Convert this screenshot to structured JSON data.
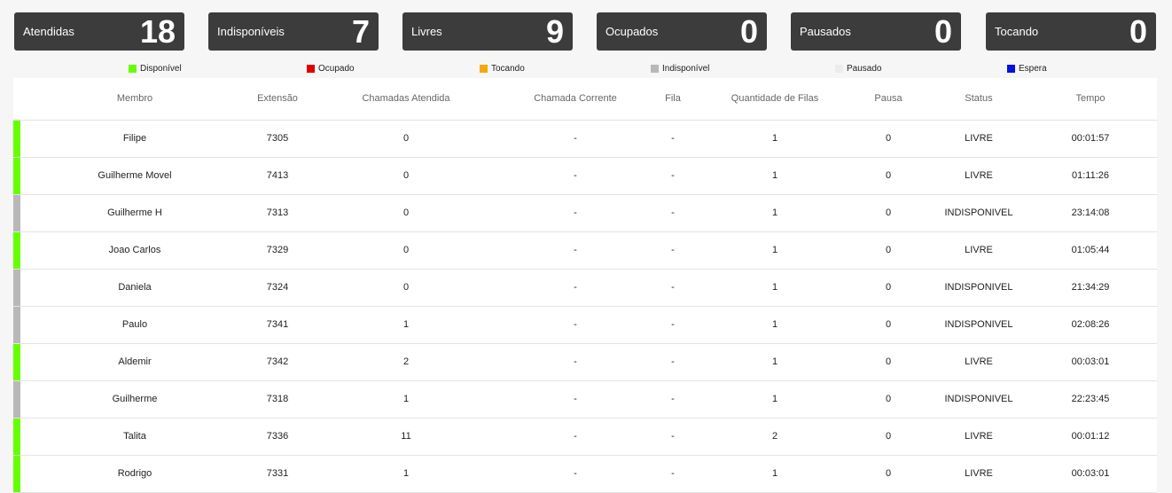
{
  "cards": [
    {
      "label": "Atendidas",
      "value": "18"
    },
    {
      "label": "Indisponíveis",
      "value": "7"
    },
    {
      "label": "Livres",
      "value": "9"
    },
    {
      "label": "Ocupados",
      "value": "0"
    },
    {
      "label": "Pausados",
      "value": "0"
    },
    {
      "label": "Tocando",
      "value": "0"
    }
  ],
  "legend": [
    {
      "label": "Disponível",
      "color": "#66ff00"
    },
    {
      "label": "Ocupado",
      "color": "#e00000"
    },
    {
      "label": "Tocando",
      "color": "#f5a800"
    },
    {
      "label": "Indisponível",
      "color": "#b8b8b8"
    },
    {
      "label": "Pausado",
      "color": "#ececec"
    },
    {
      "label": "Espera",
      "color": "#0010e0"
    }
  ],
  "table": {
    "headers": [
      "Membro",
      "Extensão",
      "Chamadas Atendida",
      "Chamada Corrente",
      "Fila",
      "Quantidade de Filas",
      "Pausa",
      "Status",
      "Tempo"
    ],
    "rows": [
      {
        "membro": "Filipe",
        "extensao": "7305",
        "atendidas": "0",
        "corrente": "-",
        "fila": "-",
        "qtd_filas": "1",
        "pausa": "0",
        "status": "LIVRE",
        "tempo": "00:01:57",
        "color": "#66ff00"
      },
      {
        "membro": "Guilherme Movel",
        "extensao": "7413",
        "atendidas": "0",
        "corrente": "-",
        "fila": "-",
        "qtd_filas": "1",
        "pausa": "0",
        "status": "LIVRE",
        "tempo": "01:11:26",
        "color": "#66ff00"
      },
      {
        "membro": "Guilherme H",
        "extensao": "7313",
        "atendidas": "0",
        "corrente": "-",
        "fila": "-",
        "qtd_filas": "1",
        "pausa": "0",
        "status": "INDISPONIVEL",
        "tempo": "23:14:08",
        "color": "#b8b8b8"
      },
      {
        "membro": "Joao Carlos",
        "extensao": "7329",
        "atendidas": "0",
        "corrente": "-",
        "fila": "-",
        "qtd_filas": "1",
        "pausa": "0",
        "status": "LIVRE",
        "tempo": "01:05:44",
        "color": "#66ff00"
      },
      {
        "membro": "Daniela",
        "extensao": "7324",
        "atendidas": "0",
        "corrente": "-",
        "fila": "-",
        "qtd_filas": "1",
        "pausa": "0",
        "status": "INDISPONIVEL",
        "tempo": "21:34:29",
        "color": "#b8b8b8"
      },
      {
        "membro": "Paulo",
        "extensao": "7341",
        "atendidas": "1",
        "corrente": "-",
        "fila": "-",
        "qtd_filas": "1",
        "pausa": "0",
        "status": "INDISPONIVEL",
        "tempo": "02:08:26",
        "color": "#b8b8b8"
      },
      {
        "membro": "Aldemir",
        "extensao": "7342",
        "atendidas": "2",
        "corrente": "-",
        "fila": "-",
        "qtd_filas": "1",
        "pausa": "0",
        "status": "LIVRE",
        "tempo": "00:03:01",
        "color": "#66ff00"
      },
      {
        "membro": "Guilherme",
        "extensao": "7318",
        "atendidas": "1",
        "corrente": "-",
        "fila": "-",
        "qtd_filas": "1",
        "pausa": "0",
        "status": "INDISPONIVEL",
        "tempo": "22:23:45",
        "color": "#b8b8b8"
      },
      {
        "membro": "Talita",
        "extensao": "7336",
        "atendidas": "11",
        "corrente": "-",
        "fila": "-",
        "qtd_filas": "2",
        "pausa": "0",
        "status": "LIVRE",
        "tempo": "00:01:12",
        "color": "#66ff00"
      },
      {
        "membro": "Rodrigo",
        "extensao": "7331",
        "atendidas": "1",
        "corrente": "-",
        "fila": "-",
        "qtd_filas": "1",
        "pausa": "0",
        "status": "LIVRE",
        "tempo": "00:03:01",
        "color": "#66ff00"
      }
    ]
  }
}
